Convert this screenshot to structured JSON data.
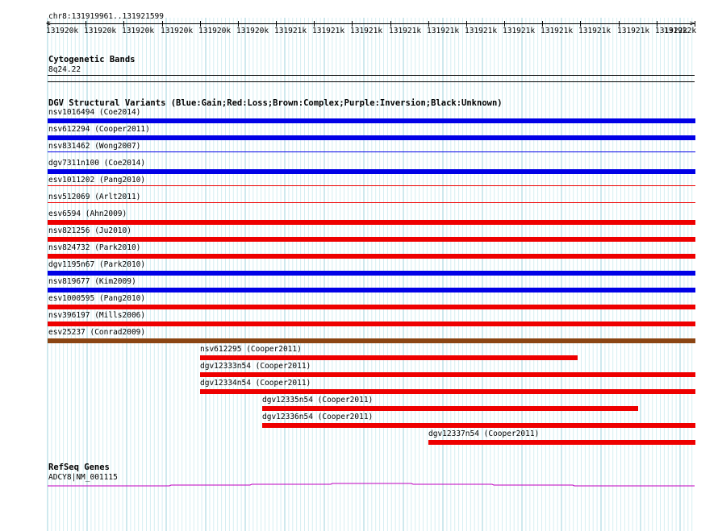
{
  "location": "chr8:131919961..131921599",
  "ruler_ticks": [
    "131920k",
    "131920k",
    "131920k",
    "131920k",
    "131920k",
    "131920k",
    "131921k",
    "131921k",
    "131921k",
    "131921k",
    "131921k",
    "131921k",
    "131921k",
    "131921k",
    "131921k",
    "131921k",
    "131922k",
    "131922k"
  ],
  "cyto": {
    "title": "Cytogenetic Bands",
    "band": "8q24.22"
  },
  "dgv": {
    "title": "DGV Structural Variants (Blue:Gain;Red:Loss;Brown:Complex;Purple:Inversion;Black:Unknown)",
    "colors": {
      "gain": "#0000e6",
      "loss": "#ee0000",
      "complex": "#8b4513"
    },
    "full_rows": [
      {
        "label": "nsv1016494 (Coe2014)",
        "type": "gain"
      },
      {
        "label": "nsv612294 (Cooper2011)",
        "type": "gain"
      },
      {
        "label": "nsv831462 (Wong2007)",
        "type": "gain"
      },
      {
        "label": "dgv7311n100 (Coe2014)",
        "type": "gain"
      },
      {
        "label": "esv1011202 (Pang2010)",
        "type": "loss"
      },
      {
        "label": "nsv512069 (Arlt2011)",
        "type": "loss"
      },
      {
        "label": "esv6594 (Ahn2009)",
        "type": "loss"
      },
      {
        "label": "nsv821256 (Ju2010)",
        "type": "loss"
      },
      {
        "label": "nsv824732 (Park2010)",
        "type": "loss"
      },
      {
        "label": "dgv1195n67 (Park2010)",
        "type": "gain"
      },
      {
        "label": "nsv819677 (Kim2009)",
        "type": "gain"
      },
      {
        "label": "esv1000595 (Pang2010)",
        "type": "loss"
      },
      {
        "label": "nsv396197 (Mills2006)",
        "type": "loss"
      },
      {
        "label": "esv25237 (Conrad2009)",
        "type": "complex"
      }
    ],
    "partial_rows": [
      {
        "label": "nsv612295 (Cooper2011)",
        "type": "loss",
        "start": 131920348,
        "end": 131921300
      },
      {
        "label": "dgv12333n54 (Cooper2011)",
        "type": "loss",
        "start": 131920348,
        "end": 131921599
      },
      {
        "label": "dgv12334n54 (Cooper2011)",
        "type": "loss",
        "start": 131920348,
        "end": 131921599
      },
      {
        "label": "dgv12335n54 (Cooper2011)",
        "type": "loss",
        "start": 131920505,
        "end": 131921455
      },
      {
        "label": "dgv12336n54 (Cooper2011)",
        "type": "loss",
        "start": 131920505,
        "end": 131921599
      },
      {
        "label": "dgv12337n54 (Cooper2011)",
        "type": "loss",
        "start": 131920925,
        "end": 131921599
      }
    ]
  },
  "refseq": {
    "title": "RefSeq Genes",
    "gene_label": "ADCY8|NM_001115",
    "color": "#c000c0"
  }
}
